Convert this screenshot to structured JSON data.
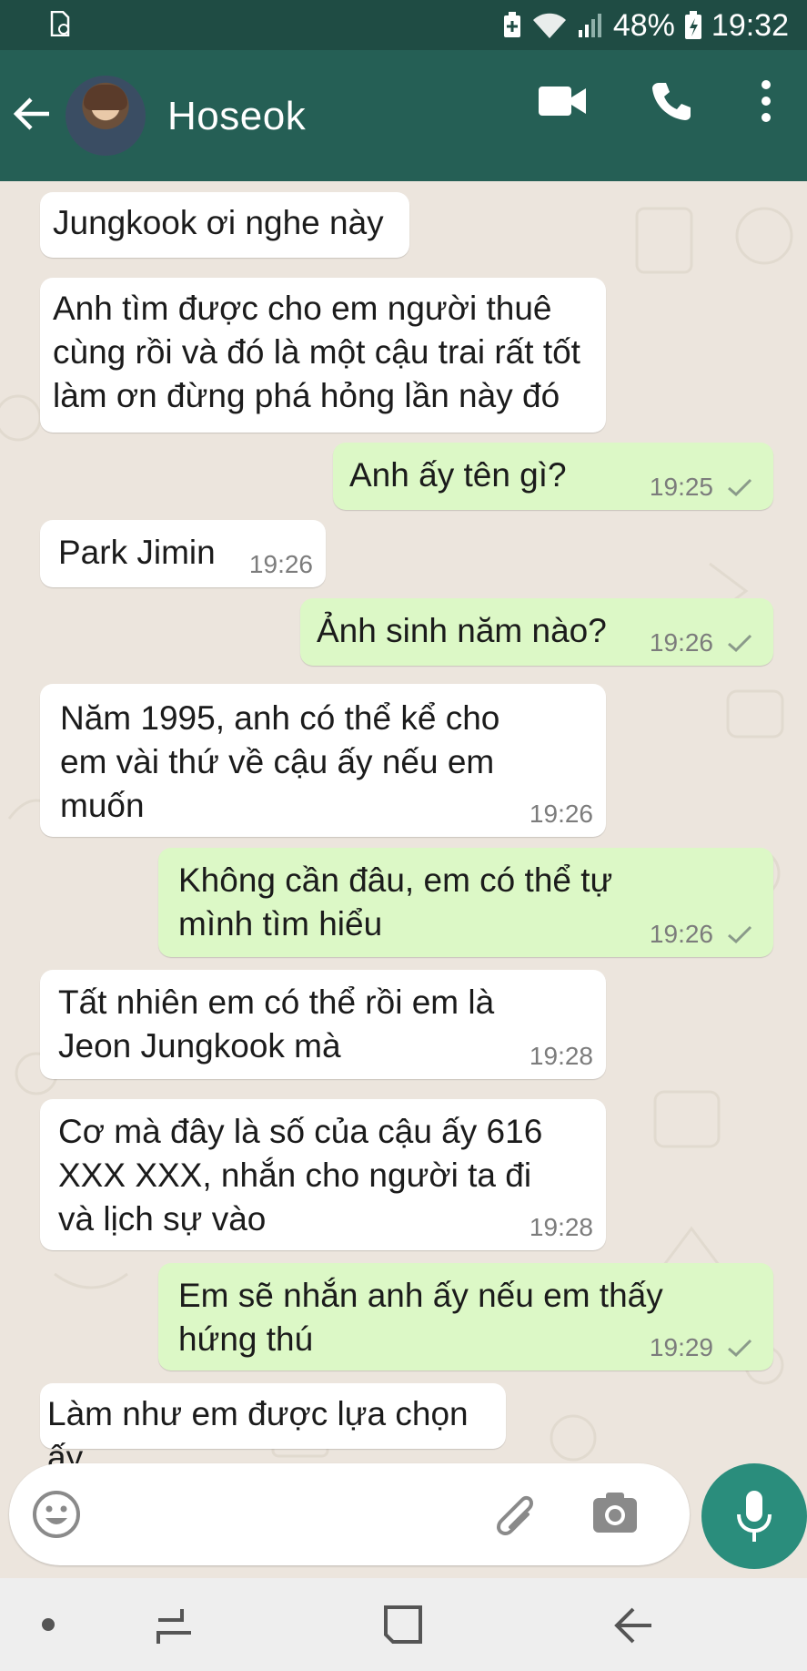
{
  "status_bar": {
    "battery": "48%",
    "time": "19:32",
    "icons": [
      "sim-card-icon",
      "battery-saver-icon",
      "wifi-icon",
      "signal-icon",
      "battery-icon"
    ]
  },
  "header": {
    "contact_name": "Hoseok",
    "icons": [
      "back-arrow-icon",
      "video-call-icon",
      "phone-icon",
      "more-vert-icon"
    ]
  },
  "messages": [
    {
      "dir": "in",
      "text": "Jungkook ơi nghe này",
      "time": ""
    },
    {
      "dir": "in",
      "text": "Anh tìm được cho em người thuê\ncùng rồi và đó là một cậu trai rất tốt\nlàm ơn đừng phá hỏng lần này đó",
      "time": ""
    },
    {
      "dir": "out",
      "text": "Anh ấy tên gì?",
      "time": "19:25"
    },
    {
      "dir": "in",
      "text": "Park Jimin",
      "time": "19:26"
    },
    {
      "dir": "out",
      "text": "Ảnh sinh năm nào?",
      "time": "19:26"
    },
    {
      "dir": "in",
      "text": "Năm 1995, anh có thể kể cho\nem vài thứ về cậu ấy nếu em\nmuốn",
      "time": "19:26"
    },
    {
      "dir": "out",
      "text": "Không cần đâu, em có thể tự\nmình tìm hiểu",
      "time": "19:26"
    },
    {
      "dir": "in",
      "text": "Tất nhiên em có thể rồi em là\nJeon Jungkook mà",
      "time": "19:28"
    },
    {
      "dir": "in",
      "text": "Cơ mà đây là số của cậu ấy 616\nXXX XXX, nhắn cho người ta đi\nvà lịch sự vào",
      "time": "19:28"
    },
    {
      "dir": "out",
      "text": "Em sẽ nhắn anh ấy nếu em thấy\nhứng thú",
      "time": "19:29"
    },
    {
      "dir": "in",
      "text": "Làm như em được lựa chọn ấy",
      "time": ""
    }
  ],
  "input_bar": {
    "placeholder": "",
    "icons": [
      "emoji-icon",
      "attach-icon",
      "camera-icon",
      "mic-icon"
    ]
  },
  "nav_bar": {
    "icons": [
      "nav-dot-icon",
      "recents-icon",
      "home-icon",
      "back-icon"
    ]
  },
  "colors": {
    "status_bar": "#1f4c44",
    "app_bar": "#255f55",
    "outgoing_bubble": "#dcf8c6",
    "incoming_bubble": "#ffffff",
    "mic_button": "#2a8d7c",
    "chat_background": "#ece5dd"
  }
}
